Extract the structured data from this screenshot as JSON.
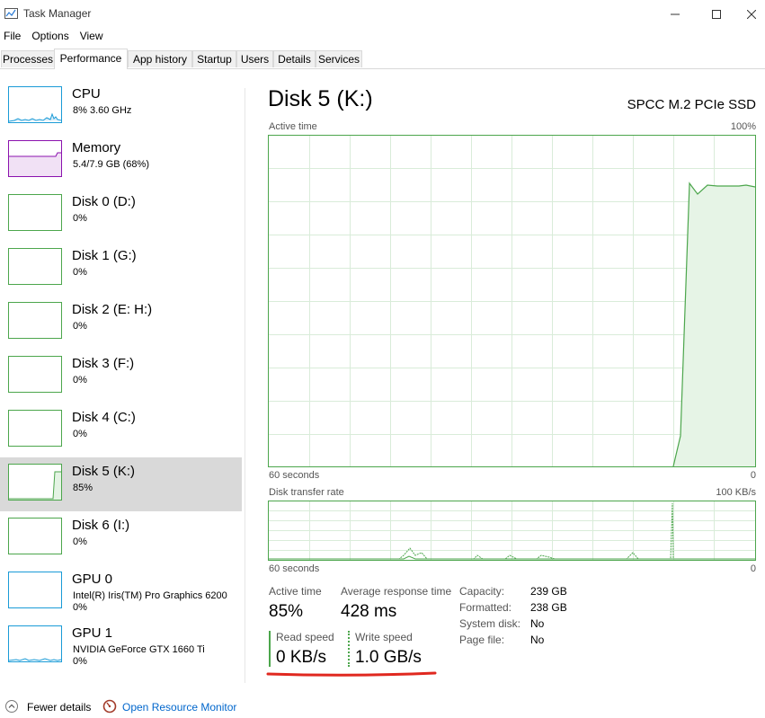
{
  "window": {
    "title": "Task Manager"
  },
  "menu": [
    "File",
    "Options",
    "View"
  ],
  "tabs": [
    "Processes",
    "Performance",
    "App history",
    "Startup",
    "Users",
    "Details",
    "Services"
  ],
  "sidebar": [
    {
      "name": "CPU",
      "sub": "8%  3.60 GHz",
      "sub2": ""
    },
    {
      "name": "Memory",
      "sub": "5.4/7.9 GB (68%)",
      "sub2": ""
    },
    {
      "name": "Disk 0 (D:)",
      "sub": "0%",
      "sub2": ""
    },
    {
      "name": "Disk 1 (G:)",
      "sub": "0%",
      "sub2": ""
    },
    {
      "name": "Disk 2 (E: H:)",
      "sub": "0%",
      "sub2": ""
    },
    {
      "name": "Disk 3 (F:)",
      "sub": "0%",
      "sub2": ""
    },
    {
      "name": "Disk 4 (C:)",
      "sub": "0%",
      "sub2": ""
    },
    {
      "name": "Disk 5 (K:)",
      "sub": "85%",
      "sub2": ""
    },
    {
      "name": "Disk 6 (I:)",
      "sub": "0%",
      "sub2": ""
    },
    {
      "name": "GPU 0",
      "sub": "Intel(R) Iris(TM) Pro Graphics 6200",
      "sub2": "0%"
    },
    {
      "name": "GPU 1",
      "sub": "NVIDIA GeForce GTX 1660 Ti",
      "sub2": "0%"
    }
  ],
  "main": {
    "title": "Disk 5 (K:)",
    "model": "SPCC M.2 PCIe SSD",
    "active_graph": {
      "label": "Active time",
      "max": "100%",
      "time": "60 seconds",
      "min": "0"
    },
    "transfer_graph": {
      "label": "Disk transfer rate",
      "max": "100 KB/s",
      "time": "60 seconds",
      "min": "0"
    },
    "stats": {
      "active_time_label": "Active time",
      "active_time_value": "85%",
      "avg_response_label": "Average response time",
      "avg_response_value": "428 ms",
      "read_label": "Read speed",
      "read_value": "0 KB/s",
      "write_label": "Write speed",
      "write_value": "1.0 GB/s"
    },
    "details": [
      {
        "label": "Capacity:",
        "value": "239 GB"
      },
      {
        "label": "Formatted:",
        "value": "238 GB"
      },
      {
        "label": "System disk:",
        "value": "No"
      },
      {
        "label": "Page file:",
        "value": "No"
      }
    ]
  },
  "bottom": {
    "fewer_details": "Fewer details",
    "resource_monitor": "Open Resource Monitor"
  },
  "colors": {
    "disk_green": "#4ca64c",
    "cpu_blue": "#1a9bd7",
    "memory_purple": "#8b12ae",
    "selected_bg": "#d9d9d9",
    "link": "#0066cc",
    "underline_red": "#e0281f"
  }
}
